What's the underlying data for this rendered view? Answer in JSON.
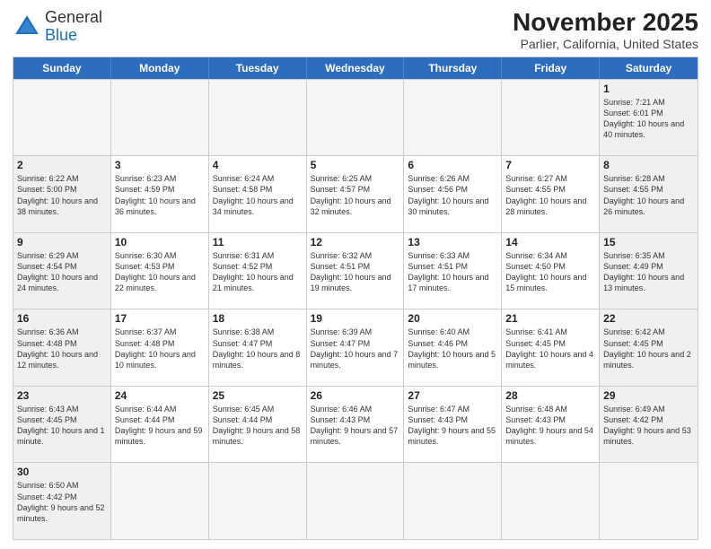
{
  "header": {
    "logo_general": "General",
    "logo_blue": "Blue",
    "title": "November 2025",
    "subtitle": "Parlier, California, United States"
  },
  "weekdays": [
    "Sunday",
    "Monday",
    "Tuesday",
    "Wednesday",
    "Thursday",
    "Friday",
    "Saturday"
  ],
  "rows": [
    [
      {
        "day": "",
        "info": ""
      },
      {
        "day": "",
        "info": ""
      },
      {
        "day": "",
        "info": ""
      },
      {
        "day": "",
        "info": ""
      },
      {
        "day": "",
        "info": ""
      },
      {
        "day": "",
        "info": ""
      },
      {
        "day": "1",
        "info": "Sunrise: 7:21 AM\nSunset: 6:01 PM\nDaylight: 10 hours\nand 40 minutes."
      }
    ],
    [
      {
        "day": "2",
        "info": "Sunrise: 6:22 AM\nSunset: 5:00 PM\nDaylight: 10 hours\nand 38 minutes."
      },
      {
        "day": "3",
        "info": "Sunrise: 6:23 AM\nSunset: 4:59 PM\nDaylight: 10 hours\nand 36 minutes."
      },
      {
        "day": "4",
        "info": "Sunrise: 6:24 AM\nSunset: 4:58 PM\nDaylight: 10 hours\nand 34 minutes."
      },
      {
        "day": "5",
        "info": "Sunrise: 6:25 AM\nSunset: 4:57 PM\nDaylight: 10 hours\nand 32 minutes."
      },
      {
        "day": "6",
        "info": "Sunrise: 6:26 AM\nSunset: 4:56 PM\nDaylight: 10 hours\nand 30 minutes."
      },
      {
        "day": "7",
        "info": "Sunrise: 6:27 AM\nSunset: 4:55 PM\nDaylight: 10 hours\nand 28 minutes."
      },
      {
        "day": "8",
        "info": "Sunrise: 6:28 AM\nSunset: 4:55 PM\nDaylight: 10 hours\nand 26 minutes."
      }
    ],
    [
      {
        "day": "9",
        "info": "Sunrise: 6:29 AM\nSunset: 4:54 PM\nDaylight: 10 hours\nand 24 minutes."
      },
      {
        "day": "10",
        "info": "Sunrise: 6:30 AM\nSunset: 4:53 PM\nDaylight: 10 hours\nand 22 minutes."
      },
      {
        "day": "11",
        "info": "Sunrise: 6:31 AM\nSunset: 4:52 PM\nDaylight: 10 hours\nand 21 minutes."
      },
      {
        "day": "12",
        "info": "Sunrise: 6:32 AM\nSunset: 4:51 PM\nDaylight: 10 hours\nand 19 minutes."
      },
      {
        "day": "13",
        "info": "Sunrise: 6:33 AM\nSunset: 4:51 PM\nDaylight: 10 hours\nand 17 minutes."
      },
      {
        "day": "14",
        "info": "Sunrise: 6:34 AM\nSunset: 4:50 PM\nDaylight: 10 hours\nand 15 minutes."
      },
      {
        "day": "15",
        "info": "Sunrise: 6:35 AM\nSunset: 4:49 PM\nDaylight: 10 hours\nand 13 minutes."
      }
    ],
    [
      {
        "day": "16",
        "info": "Sunrise: 6:36 AM\nSunset: 4:48 PM\nDaylight: 10 hours\nand 12 minutes."
      },
      {
        "day": "17",
        "info": "Sunrise: 6:37 AM\nSunset: 4:48 PM\nDaylight: 10 hours\nand 10 minutes."
      },
      {
        "day": "18",
        "info": "Sunrise: 6:38 AM\nSunset: 4:47 PM\nDaylight: 10 hours\nand 8 minutes."
      },
      {
        "day": "19",
        "info": "Sunrise: 6:39 AM\nSunset: 4:47 PM\nDaylight: 10 hours\nand 7 minutes."
      },
      {
        "day": "20",
        "info": "Sunrise: 6:40 AM\nSunset: 4:46 PM\nDaylight: 10 hours\nand 5 minutes."
      },
      {
        "day": "21",
        "info": "Sunrise: 6:41 AM\nSunset: 4:45 PM\nDaylight: 10 hours\nand 4 minutes."
      },
      {
        "day": "22",
        "info": "Sunrise: 6:42 AM\nSunset: 4:45 PM\nDaylight: 10 hours\nand 2 minutes."
      }
    ],
    [
      {
        "day": "23",
        "info": "Sunrise: 6:43 AM\nSunset: 4:45 PM\nDaylight: 10 hours\nand 1 minute."
      },
      {
        "day": "24",
        "info": "Sunrise: 6:44 AM\nSunset: 4:44 PM\nDaylight: 9 hours\nand 59 minutes."
      },
      {
        "day": "25",
        "info": "Sunrise: 6:45 AM\nSunset: 4:44 PM\nDaylight: 9 hours\nand 58 minutes."
      },
      {
        "day": "26",
        "info": "Sunrise: 6:46 AM\nSunset: 4:43 PM\nDaylight: 9 hours\nand 57 minutes."
      },
      {
        "day": "27",
        "info": "Sunrise: 6:47 AM\nSunset: 4:43 PM\nDaylight: 9 hours\nand 55 minutes."
      },
      {
        "day": "28",
        "info": "Sunrise: 6:48 AM\nSunset: 4:43 PM\nDaylight: 9 hours\nand 54 minutes."
      },
      {
        "day": "29",
        "info": "Sunrise: 6:49 AM\nSunset: 4:42 PM\nDaylight: 9 hours\nand 53 minutes."
      }
    ],
    [
      {
        "day": "30",
        "info": "Sunrise: 6:50 AM\nSunset: 4:42 PM\nDaylight: 9 hours\nand 52 minutes."
      },
      {
        "day": "",
        "info": ""
      },
      {
        "day": "",
        "info": ""
      },
      {
        "day": "",
        "info": ""
      },
      {
        "day": "",
        "info": ""
      },
      {
        "day": "",
        "info": ""
      },
      {
        "day": "",
        "info": ""
      }
    ]
  ]
}
